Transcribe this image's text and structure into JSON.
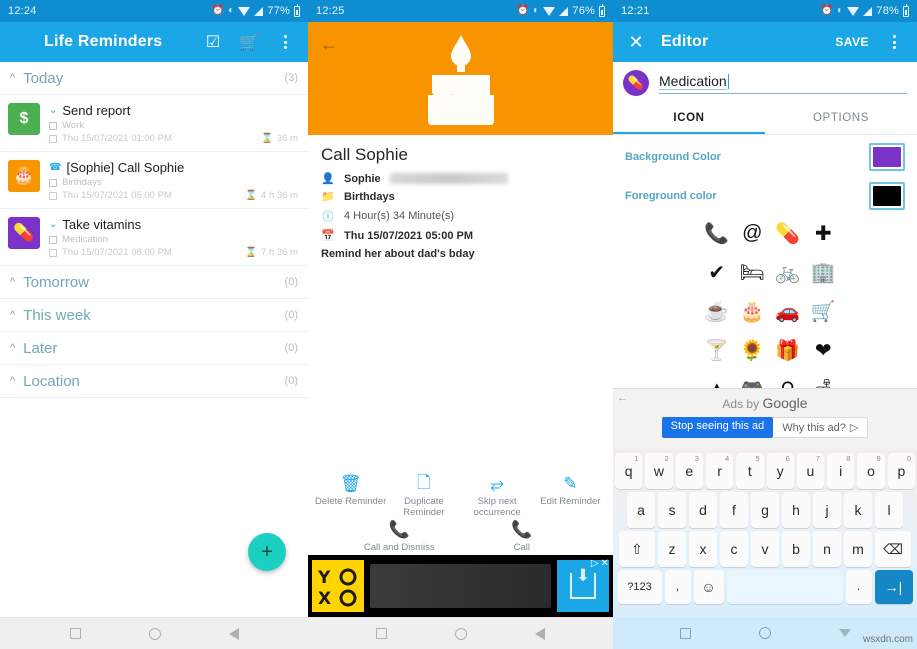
{
  "left_panel": {
    "status": {
      "time": "12:24",
      "battery": "77%",
      "icons": [
        "alarm-icon",
        "do-not-disturb-icon",
        "wifi-icon",
        "signal-icon",
        "battery-icon"
      ]
    },
    "appbar": {
      "title": "Life Reminders",
      "menu_icon": "hamburger-icon",
      "action_icons": [
        "edit-check-icon",
        "cart-icon",
        "overflow-menu-icon"
      ]
    },
    "groups": [
      {
        "name": "Today",
        "count": "(3)"
      },
      {
        "name": "Tomorrow",
        "count": "(0)"
      },
      {
        "name": "This week",
        "count": "(0)"
      },
      {
        "name": "Later",
        "count": "(0)"
      },
      {
        "name": "Location",
        "count": "(0)"
      }
    ],
    "reminders": [
      {
        "title": "Send report",
        "category": "Work",
        "date": "Thu 15/07/2021 01:00 PM",
        "remaining": "36 m",
        "icon_glyph": "$",
        "icon_bg": "#4caf50",
        "type_icon": "chevron-down-icon"
      },
      {
        "title": "[Sophie] Call Sophie",
        "category": "Birthdays",
        "date": "Thu 15/07/2021 05:00 PM",
        "remaining": "4 h 36 m",
        "icon_glyph": "🎂",
        "icon_bg": "#f79400",
        "type_icon": "phone-icon"
      },
      {
        "title": "Take vitamins",
        "category": "Medication",
        "date": "Thu 15/07/2021 08:00 PM",
        "remaining": "7 h 36 m",
        "icon_glyph": "💊",
        "icon_bg": "#7b32c9",
        "type_icon": "chevron-down-icon"
      }
    ],
    "fab_label": "+",
    "nav": [
      "recents-square-icon",
      "home-circle-icon",
      "back-triangle-icon"
    ]
  },
  "mid_panel": {
    "status": {
      "time": "12:25",
      "battery": "76%"
    },
    "hero": {
      "back_icon": "back-arrow-icon",
      "image": "birthday-cake-icon",
      "bg_color": "#f79400"
    },
    "detail": {
      "title": "Call Sophie",
      "rows": [
        {
          "icon": "contact-icon",
          "text": "Sophie",
          "redacted": true
        },
        {
          "icon": "folder-icon",
          "text": "Birthdays",
          "redacted": false
        },
        {
          "icon": "clock-info-icon",
          "text": "4 Hour(s) 34 Minute(s)",
          "redacted": false,
          "light": true
        },
        {
          "icon": "calendar-icon",
          "text": "Thu 15/07/2021 05:00 PM",
          "redacted": false
        }
      ],
      "note": "Remind her about dad's bday"
    },
    "actions_row1": [
      {
        "label": "Delete Reminder",
        "icon": "trash-icon"
      },
      {
        "label": "Duplicate Reminder",
        "icon": "copy-icon"
      },
      {
        "label": "Skip next occurrence",
        "icon": "skip-arrow-icon"
      },
      {
        "label": "Edit Reminder",
        "icon": "pencil-icon"
      }
    ],
    "actions_row2": [
      {
        "label": "Call and Dismiss",
        "icon": "phone-icon"
      },
      {
        "label": "Call",
        "icon": "phone-icon"
      }
    ],
    "ad": {
      "logo_text": "YO\nXO",
      "cta_icon": "download-icon",
      "badges": [
        "ad-choices-icon",
        "close-icon"
      ]
    },
    "nav": [
      "recents-square-icon",
      "home-circle-icon",
      "back-triangle-icon"
    ]
  },
  "right_panel": {
    "status": {
      "time": "12:21",
      "battery": "78%"
    },
    "appbar": {
      "close_icon": "close-icon",
      "title": "Editor",
      "save_label": "SAVE",
      "overflow_icon": "overflow-menu-icon"
    },
    "name_field": {
      "value": "Medication",
      "avatar_icon": "pill-icon",
      "avatar_bg": "#7b32c9"
    },
    "tabs": [
      {
        "label": "ICON",
        "active": true
      },
      {
        "label": "OPTIONS",
        "active": false
      }
    ],
    "colors": [
      {
        "label": "Background Color",
        "value": "#7b32c9"
      },
      {
        "label": "Foreground color",
        "value": "#000000"
      }
    ],
    "icon_grid": [
      "phone-icon",
      "at-sign-icon",
      "pill-icon",
      "medical-cross-icon",
      "check-icon",
      "bed-icon",
      "bicycle-icon",
      "office-building-icon",
      "coffee-cup-icon",
      "birthday-cake-icon",
      "car-icon",
      "shopping-cart-icon",
      "cocktail-glass-icon",
      "flower-icon",
      "gift-icon",
      "heart-icon",
      "mountain-icon",
      "game-controller-icon",
      "lamp-icon",
      "sofa-icon"
    ],
    "icon_glyphs": [
      "📞",
      "@",
      "💊",
      "✚",
      "✔",
      "🛏",
      "🚲",
      "🏢",
      "☕",
      "🎂",
      "🚗",
      "🛒",
      "🍸",
      "🌻",
      "🎁",
      "❤",
      "▲",
      "🎮",
      "⚲",
      "🛋"
    ],
    "google_ad": {
      "title_prefix": "Ads by ",
      "title_brand": "Google",
      "stop_label": "Stop seeing this ad",
      "why_label": "Why this ad?",
      "back_icon": "back-arrow-icon"
    },
    "keyboard": {
      "row1": [
        {
          "k": "q",
          "n": "1"
        },
        {
          "k": "w",
          "n": "2"
        },
        {
          "k": "e",
          "n": "3"
        },
        {
          "k": "r",
          "n": "4"
        },
        {
          "k": "t",
          "n": "5"
        },
        {
          "k": "y",
          "n": "6"
        },
        {
          "k": "u",
          "n": "7"
        },
        {
          "k": "i",
          "n": "8"
        },
        {
          "k": "o",
          "n": "9"
        },
        {
          "k": "p",
          "n": "0"
        }
      ],
      "row2": [
        "a",
        "s",
        "d",
        "f",
        "g",
        "h",
        "j",
        "k",
        "l"
      ],
      "row3": [
        "⇧",
        "z",
        "x",
        "c",
        "v",
        "b",
        "n",
        "m",
        "⌫"
      ],
      "row4": [
        "?123",
        ",",
        "☺",
        "",
        ".",
        "→|"
      ]
    },
    "nav": [
      "recents-square-icon",
      "home-circle-icon",
      "dropdown-triangle-icon"
    ],
    "watermark": "wsxdn.com"
  }
}
